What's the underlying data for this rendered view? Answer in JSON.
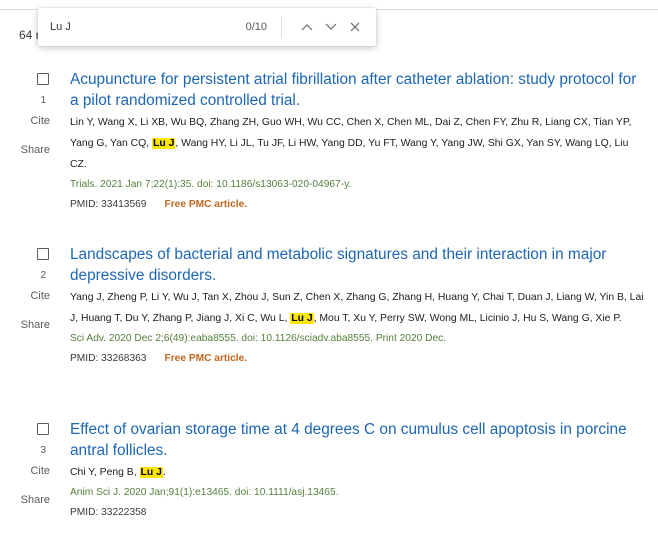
{
  "results_count": "64 r",
  "find_bar": {
    "query": "Lu J",
    "match_count": "0/10",
    "prev_icon": "chevron-up-icon",
    "next_icon": "chevron-down-icon",
    "close_icon": "close-icon"
  },
  "actions": {
    "cite": "Cite",
    "share": "Share",
    "free_pmc": "Free PMC article."
  },
  "colors": {
    "title": "#1d66b3",
    "citation": "#547f3b",
    "highlight": "#ffe600",
    "free_pmc": "#c0661f"
  },
  "results": [
    {
      "number": "1",
      "title": "Acupuncture for persistent atrial fibrillation after catheter ablation: study protocol for a pilot randomized controlled trial.",
      "authors_before": "Lin Y, Wang X, Li XB, Wu BQ, Zhang ZH, Guo WH, Wu CC, Chen X, Chen ML, Dai Z, Chen FY, Zhu R, Liang CX, Tian YP, Yang G, Yan CQ, ",
      "authors_highlight": "Lu J",
      "authors_after": ", Wang HY, Li JL, Tu JF, Li HW, Yang DD, Yu FT, Wang Y, Yang JW, Shi GX, Yan SY, Wang LQ, Liu CZ.",
      "citation": "Trials. 2021 Jan 7;22(1):35. doi: 10.1186/s13063-020-04967-y.",
      "pmid": "PMID: 33413569"
    },
    {
      "number": "2",
      "title": "Landscapes of bacterial and metabolic signatures and their interaction in major depressive disorders.",
      "authors_before": "Yang J, Zheng P, Li Y, Wu J, Tan X, Zhou J, Sun Z, Chen X, Zhang G, Zhang H, Huang Y, Chai T, Duan J, Liang W, Yin B, Lai J, Huang T, Du Y, Zhang P, Jiang J, Xi C, Wu L, ",
      "authors_highlight": "Lu J",
      "authors_after": ", Mou T, Xu Y, Perry SW, Wong ML, Licinio J, Hu S, Wang G, Xie P.",
      "citation": "Sci Adv. 2020 Dec 2;6(49):eaba8555. doi: 10.1126/sciadv.aba8555. Print 2020 Dec.",
      "pmid": "PMID: 33268363"
    },
    {
      "number": "3",
      "title": "Effect of ovarian storage time at 4 degrees C on cumulus cell apoptosis in porcine antral follicles.",
      "authors_before": "Chi Y, Peng B, ",
      "authors_highlight": "Lu J",
      "authors_after": ".",
      "citation": "Anim Sci J. 2020 Jan;91(1):e13465. doi: 10.1111/asj.13465.",
      "pmid": "PMID: 33222358"
    }
  ]
}
